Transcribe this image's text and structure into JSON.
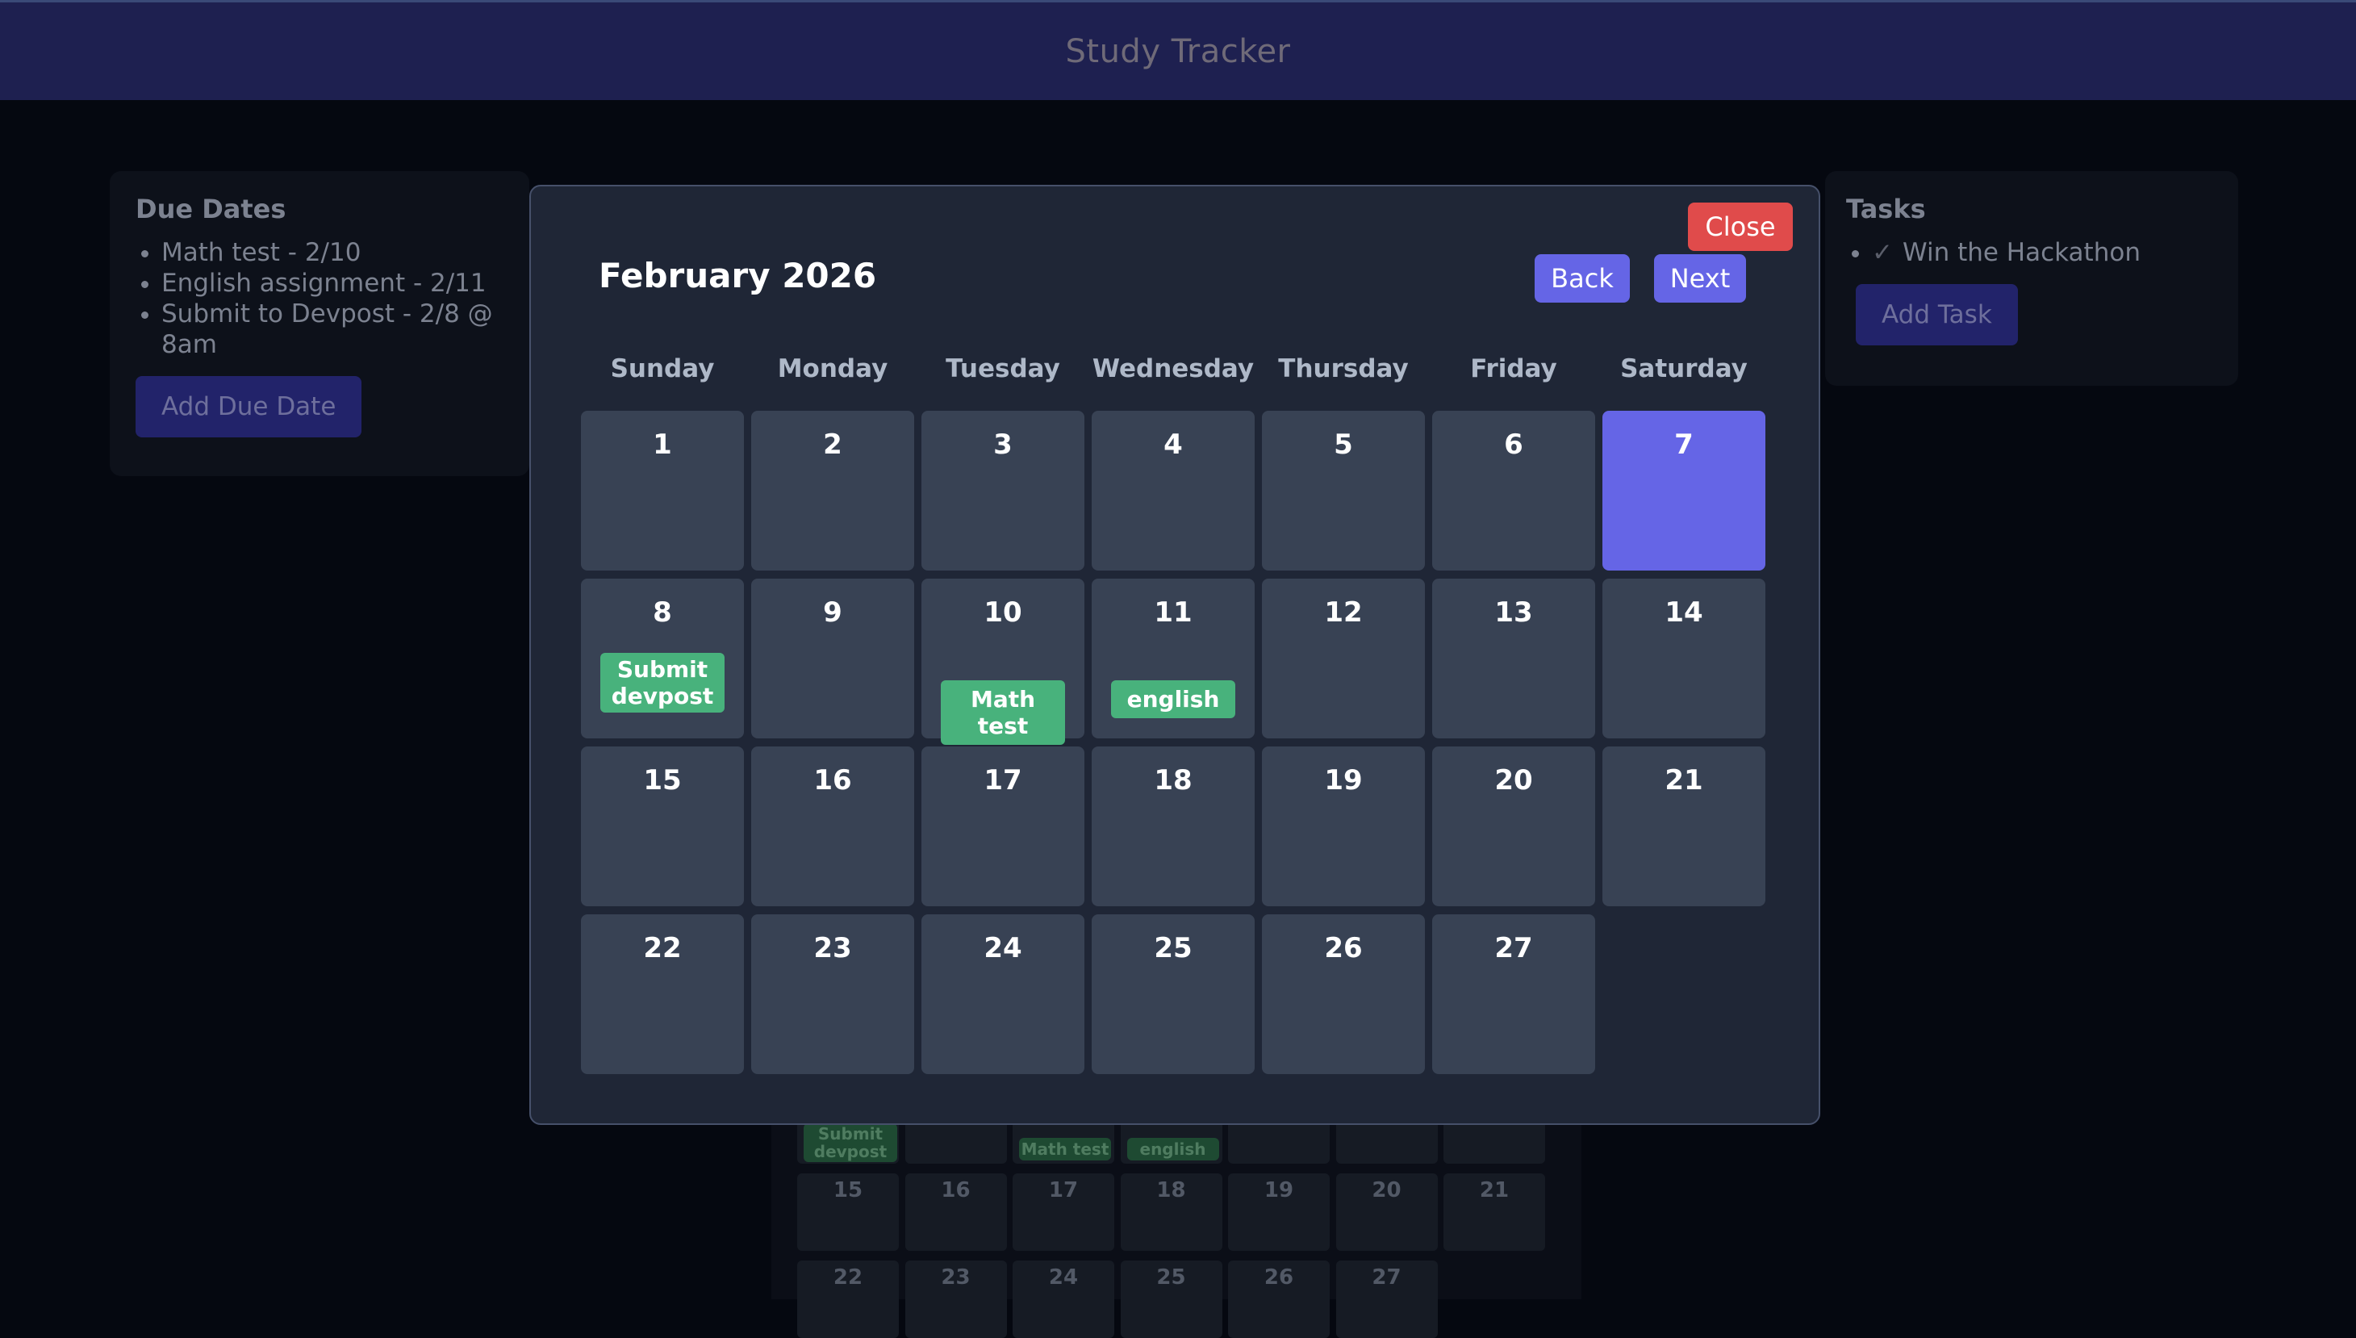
{
  "header": {
    "title": "Study Tracker"
  },
  "due_dates": {
    "title": "Due Dates",
    "items": [
      "Math test - 2/10",
      "English assignment - 2/11",
      "Submit to Devpost - 2/8 @ 8am"
    ],
    "add_button": "Add Due Date"
  },
  "tasks": {
    "title": "Tasks",
    "items": [
      {
        "label": "Win the Hackathon",
        "done": true,
        "check_glyph": "✓"
      }
    ],
    "add_button": "Add Task"
  },
  "modal": {
    "close_label": "Close",
    "month_title": "February 2026",
    "back_label": "Back",
    "next_label": "Next",
    "weekdays": [
      "Sunday",
      "Monday",
      "Tuesday",
      "Wednesday",
      "Thursday",
      "Friday",
      "Saturday"
    ],
    "today": 7,
    "days": [
      1,
      2,
      3,
      4,
      5,
      6,
      7,
      8,
      9,
      10,
      11,
      12,
      13,
      14,
      15,
      16,
      17,
      18,
      19,
      20,
      21,
      22,
      23,
      24,
      25,
      26,
      27
    ],
    "events": [
      {
        "day": 8,
        "label": "Submit devpost"
      },
      {
        "day": 10,
        "label": "Math test"
      },
      {
        "day": 11,
        "label": "english"
      }
    ]
  },
  "colors": {
    "accent": "#6565e6",
    "danger": "#e04b4b",
    "event": "#48b27c",
    "cell": "#384254",
    "modal_bg": "#1f2636"
  },
  "background_calendar": {
    "rows": [
      [],
      [
        15,
        16,
        17,
        18,
        19,
        20,
        21
      ],
      [
        22,
        23,
        24,
        25,
        26,
        27
      ]
    ],
    "tags": [
      {
        "label": "Submit devpost",
        "col": 0
      },
      {
        "label": "Math test",
        "col": 2
      },
      {
        "label": "english",
        "col": 3
      }
    ]
  }
}
